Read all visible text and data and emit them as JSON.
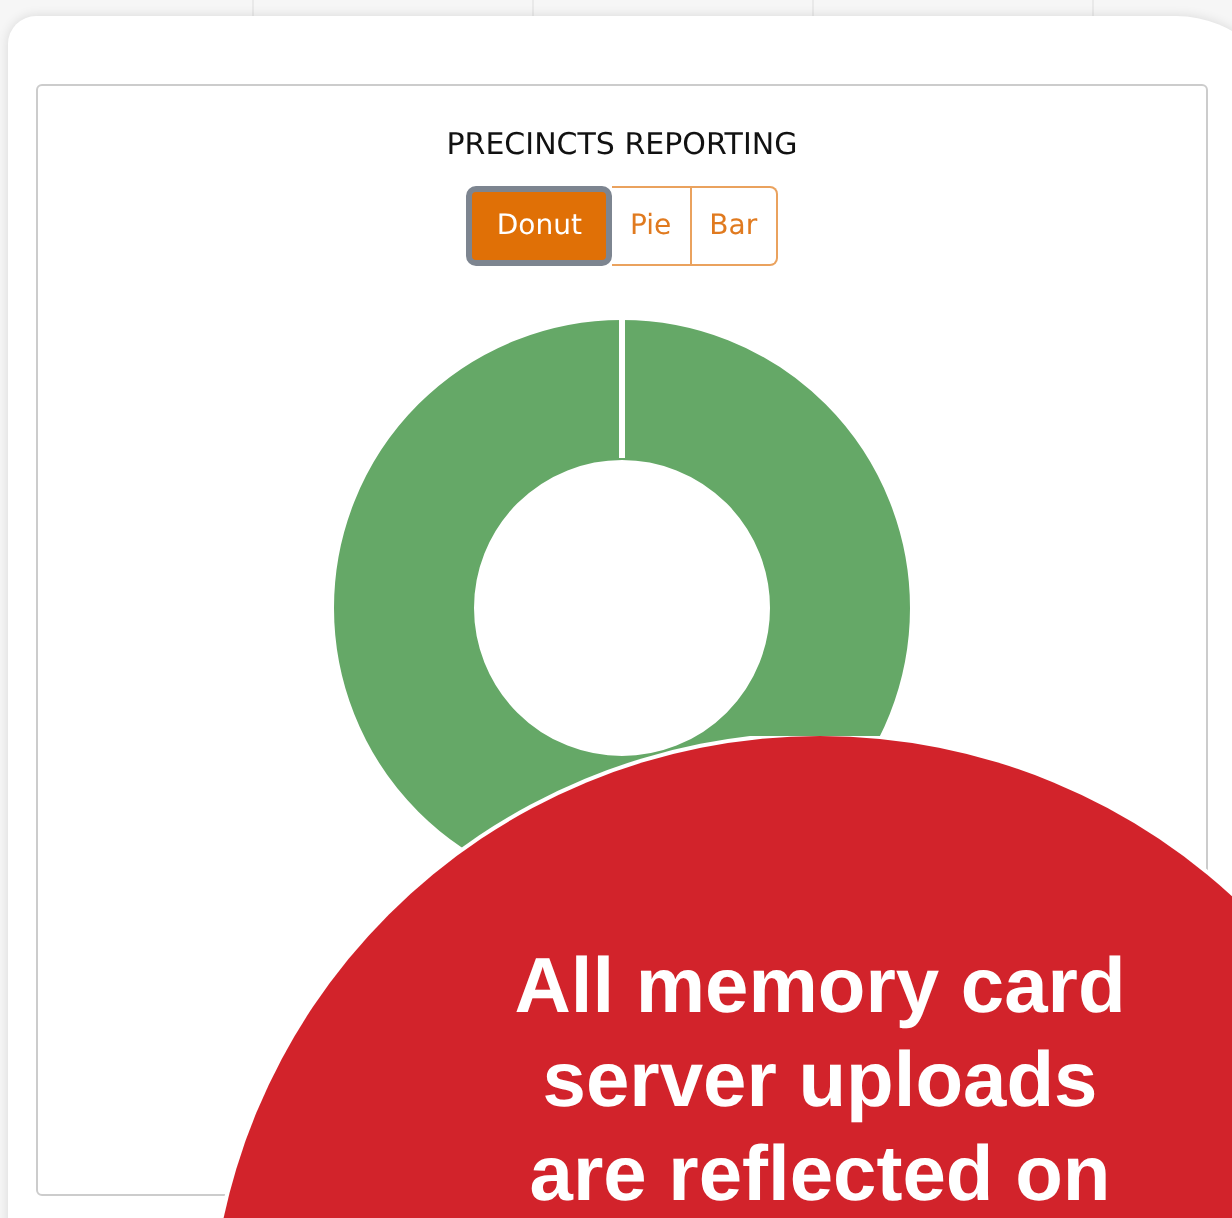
{
  "card": {
    "title": "PRECINCTS REPORTING",
    "chart_types": [
      {
        "label": "Donut",
        "selected": true
      },
      {
        "label": "Pie",
        "selected": false
      },
      {
        "label": "Bar",
        "selected": false
      }
    ]
  },
  "callout": {
    "text": "All memory card server uploads are reflected on"
  }
}
